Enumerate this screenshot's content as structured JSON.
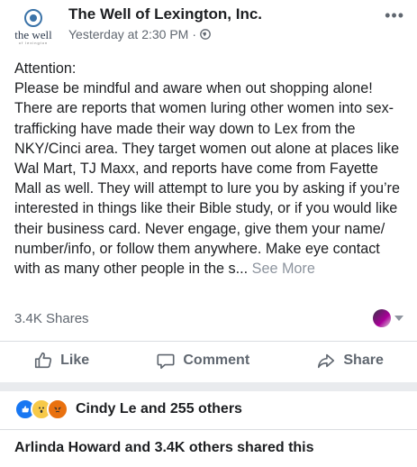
{
  "post": {
    "page_name": "The Well of Lexington, Inc.",
    "avatar_text": "the well",
    "avatar_subtext": "of lexington",
    "timestamp": "Yesterday at 2:30 PM",
    "separator": "·",
    "privacy_icon": "globe-icon",
    "more_icon": "more-options-icon",
    "more_label": "•••",
    "body": "Attention:\nPlease be mindful and aware when out shopping alone! There are reports that women luring other women into sex-trafficking have made their way down to Lex from the NKY/Cinci area. They target women out alone at places like Wal Mart, TJ Maxx, and reports have come from Fayette Mall as well. They will attempt to lure you by asking if you’re interested in things like their Bible study, or if you would like their business card. Never engage, give them your name/ number/info, or follow them anywhere. Make eye contact with as many other people in the s... ",
    "see_more": "See More"
  },
  "stats": {
    "shares": "3.4K Shares"
  },
  "actions": {
    "like": "Like",
    "comment": "Comment",
    "share": "Share"
  },
  "reactions": {
    "names": "Cindy Le and 255 others",
    "icons": [
      "like-reaction-icon",
      "wow-reaction-icon",
      "angry-reaction-icon"
    ],
    "colors": {
      "like": "#1877f2",
      "wow": "#f7c948",
      "angry": "#e9710f"
    }
  },
  "shared": {
    "text": "Arlinda Howard and 3.4K others shared this"
  }
}
